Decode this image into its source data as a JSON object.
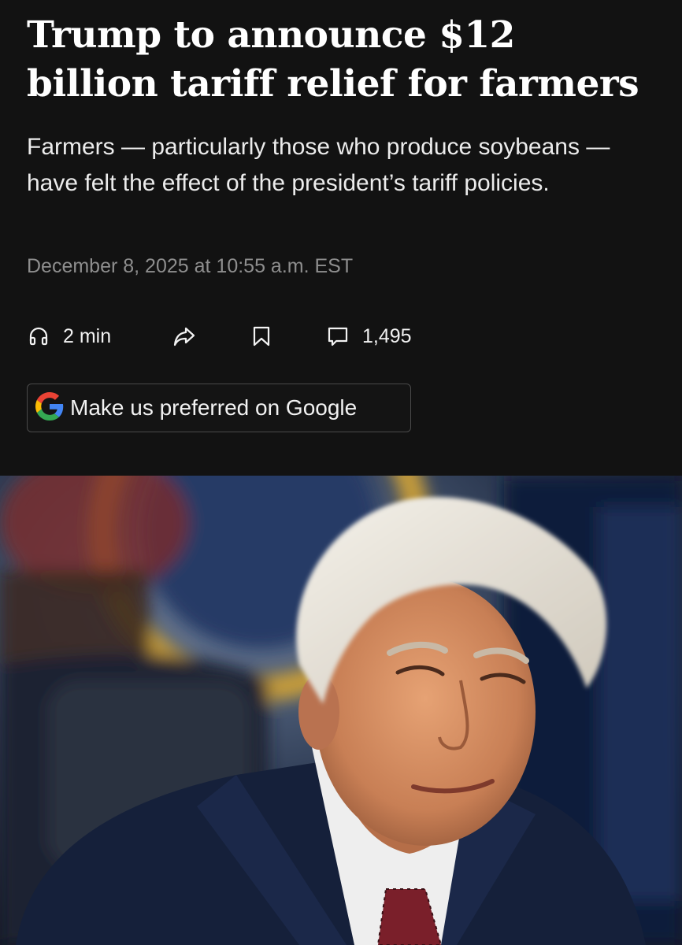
{
  "article": {
    "headline": "Trump to announce $12 billion tariff relief for farmers",
    "dek": "Farmers — particularly those who produce soybeans — have felt the effect of the president’s tariff policies.",
    "timestamp": "December 8, 2025 at 10:55 a.m. EST"
  },
  "actions": {
    "listen": {
      "icon": "headphones-icon",
      "label": "2 min"
    },
    "share": {
      "icon": "share-arrow-icon"
    },
    "save": {
      "icon": "bookmark-icon"
    },
    "comments": {
      "icon": "comment-icon",
      "count": "1,495"
    }
  },
  "google_button": {
    "icon": "google-g-icon",
    "label": "Make us preferred on Google"
  },
  "lead_image": {
    "subject": "portrait photo"
  },
  "colors": {
    "background": "#121212",
    "headline": "#ffffff",
    "dek": "#ececec",
    "timestamp": "#8e8e8e",
    "button_border": "#4a4a4a"
  }
}
